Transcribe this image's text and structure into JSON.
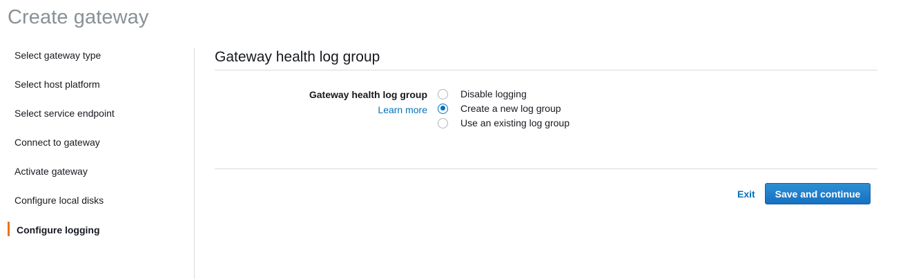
{
  "page": {
    "title": "Create gateway"
  },
  "sidebar": {
    "steps": [
      {
        "label": "Select gateway type",
        "active": false
      },
      {
        "label": "Select host platform",
        "active": false
      },
      {
        "label": "Select service endpoint",
        "active": false
      },
      {
        "label": "Connect to gateway",
        "active": false
      },
      {
        "label": "Activate gateway",
        "active": false
      },
      {
        "label": "Configure local disks",
        "active": false
      },
      {
        "label": "Configure logging",
        "active": true
      }
    ]
  },
  "main": {
    "section_title": "Gateway health log group",
    "field": {
      "label": "Gateway health log group",
      "help_link": "Learn more",
      "options": [
        {
          "label": "Disable logging",
          "selected": false
        },
        {
          "label": "Create a new log group",
          "selected": true
        },
        {
          "label": "Use an existing log group",
          "selected": false
        }
      ]
    }
  },
  "footer": {
    "exit_label": "Exit",
    "primary_label": "Save and continue"
  },
  "colors": {
    "accent": "#0073bb",
    "active_marker": "#ec7211",
    "title_gray": "#879196"
  }
}
